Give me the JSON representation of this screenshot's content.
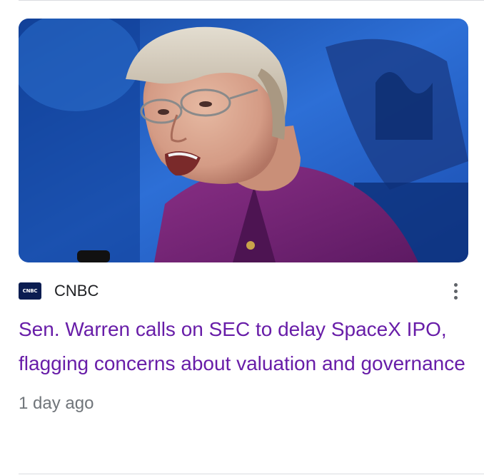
{
  "card": {
    "image_alt": "Photo of Sen. Elizabeth Warren speaking",
    "source": {
      "logo_text": "CNBC",
      "name": "CNBC"
    },
    "more_options_icon": "more-vert-icon",
    "headline": "Sen. Warren calls on SEC to delay SpaceX IPO, flagging concerns about valuation and governance",
    "timestamp": "1 day ago"
  },
  "colors": {
    "headline": "#681da8",
    "source": "#202124",
    "timestamp": "#70757a",
    "divider": "#dadce0"
  }
}
